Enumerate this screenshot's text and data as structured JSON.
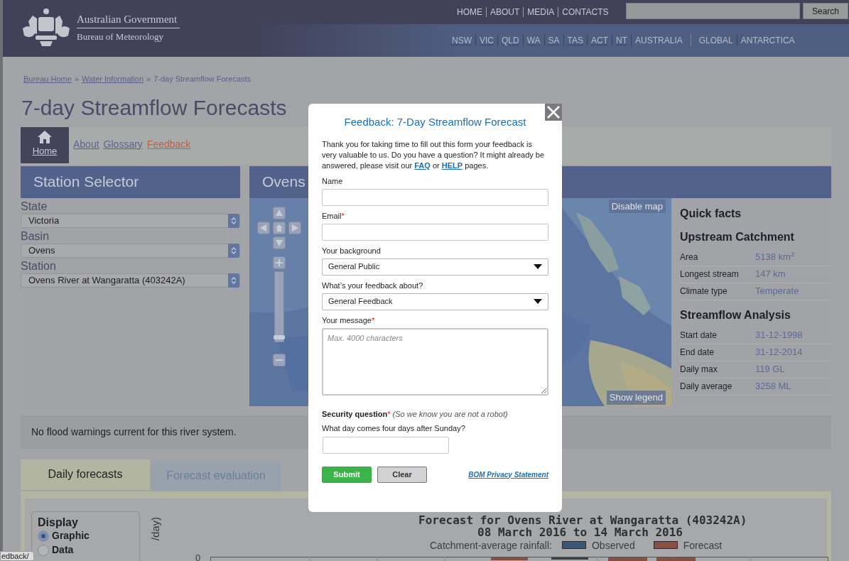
{
  "header": {
    "org_line1": "Australian Government",
    "org_line2": "Bureau of Meteorology",
    "top_links": [
      "HOME",
      "ABOUT",
      "MEDIA",
      "CONTACTS"
    ],
    "search_button": "Search",
    "region_links": [
      {
        "label": "NSW",
        "kind": "state"
      },
      {
        "label": "VIC",
        "kind": "state"
      },
      {
        "label": "QLD",
        "kind": "state"
      },
      {
        "label": "WA",
        "kind": "state"
      },
      {
        "label": "SA",
        "kind": "state"
      },
      {
        "label": "TAS",
        "kind": "state"
      },
      {
        "label": "ACT",
        "kind": "state"
      },
      {
        "label": "NT",
        "kind": "state"
      },
      {
        "label": "AUSTRALIA",
        "kind": "wide"
      },
      {
        "label": "GLOBAL",
        "kind": "wide"
      },
      {
        "label": "ANTARCTICA",
        "kind": "wide"
      }
    ]
  },
  "breadcrumb": {
    "separator": "»",
    "items": [
      {
        "label": "Bureau Home",
        "link": true
      },
      {
        "label": "Water Information",
        "link": true
      },
      {
        "label": "7-day Streamflow Forecasts",
        "link": false
      }
    ]
  },
  "page_title": "7-day Streamflow Forecasts",
  "nav": [
    {
      "label": "Home",
      "kind": "home"
    },
    {
      "label": "About",
      "kind": "link"
    },
    {
      "label": "Glossary",
      "kind": "link"
    },
    {
      "label": "Feedback",
      "kind": "highlight"
    }
  ],
  "station_selector": {
    "title": "Station Selector",
    "fields": [
      {
        "label": "State",
        "value": "Victoria"
      },
      {
        "label": "Basin",
        "value": "Ovens"
      },
      {
        "label": "Station",
        "value": "Ovens River at Wangaratta (403242A)"
      }
    ]
  },
  "map_panel": {
    "title": "Ovens",
    "zoom": {
      "level": 0.05
    },
    "disable_map": "Disable map",
    "show_legend": "Show legend"
  },
  "quick_facts": {
    "title": "Quick facts",
    "sections": [
      {
        "heading": "Upstream Catchment",
        "rows": [
          {
            "label": "Area",
            "value": "5138 km$^{2}$"
          },
          {
            "label": "Longest stream",
            "value": "147 km"
          },
          {
            "label": "Climate type",
            "value": "Temperate"
          }
        ]
      },
      {
        "heading": "Streamflow Analysis",
        "rows": [
          {
            "label": "Start date",
            "value": "31-12-1998"
          },
          {
            "label": "End date",
            "value": "31-12-2014"
          },
          {
            "label": "Daily max",
            "value": "119 GL"
          },
          {
            "label": "Daily average",
            "value": "3258 ML"
          }
        ]
      }
    ]
  },
  "warning": "No flood warnings current for this river system.",
  "tabs": [
    {
      "label": "Daily forecasts",
      "selected": true
    },
    {
      "label": "Forecast evaluation",
      "selected": false
    }
  ],
  "display": {
    "title": "Display",
    "options": [
      {
        "label": "Graphic",
        "selected": true
      },
      {
        "label": "Data",
        "selected": false
      }
    ]
  },
  "chart": {
    "title": "Forecast for Ovens River at Wangaratta (403242A)",
    "subtitle": "08 March 2016 to 14 March 2016",
    "legend_title": "Catchment-average rainfall:",
    "legend": [
      {
        "label": "Observed",
        "color": "#3e5676"
      },
      {
        "label": "Forecast",
        "color": "#8c4e3e"
      }
    ],
    "ylabel": "/day)",
    "ytick": "0"
  },
  "status_url": "edback/",
  "dialog": {
    "title": "Feedback: 7-Day Streamflow Forecast",
    "required_mark": "*",
    "intro": [
      {
        "text": "Thank you for taking time to fill out this form your feedback is very valuable to us. Do you have a question? It might already be answered, please visit our "
      },
      {
        "text": "FAQ",
        "link": true
      },
      {
        "text": " or "
      },
      {
        "text": "HELP",
        "link": true
      },
      {
        "text": " pages."
      }
    ],
    "fields": [
      {
        "kind": "text",
        "label": "Name",
        "required": false
      },
      {
        "kind": "text",
        "label": "Email",
        "required": true
      },
      {
        "kind": "select",
        "label": "Your background",
        "value": "General Public",
        "required": false
      },
      {
        "kind": "select",
        "label": "What’s your feedback about?",
        "value": "General Feedback",
        "required": false
      },
      {
        "kind": "textarea",
        "label": "Your message",
        "required": true,
        "placeholder": "Max. 4000 characters"
      }
    ],
    "security": {
      "label": "Security question",
      "required": true,
      "note": "(So we know you are not a robot)",
      "question": "What day comes four days after Sunday?"
    },
    "buttons": [
      {
        "label": "Submit",
        "kind": "primary"
      },
      {
        "label": "Clear",
        "kind": "secondary"
      }
    ],
    "privacy_link": "BOM Privacy Statement"
  }
}
